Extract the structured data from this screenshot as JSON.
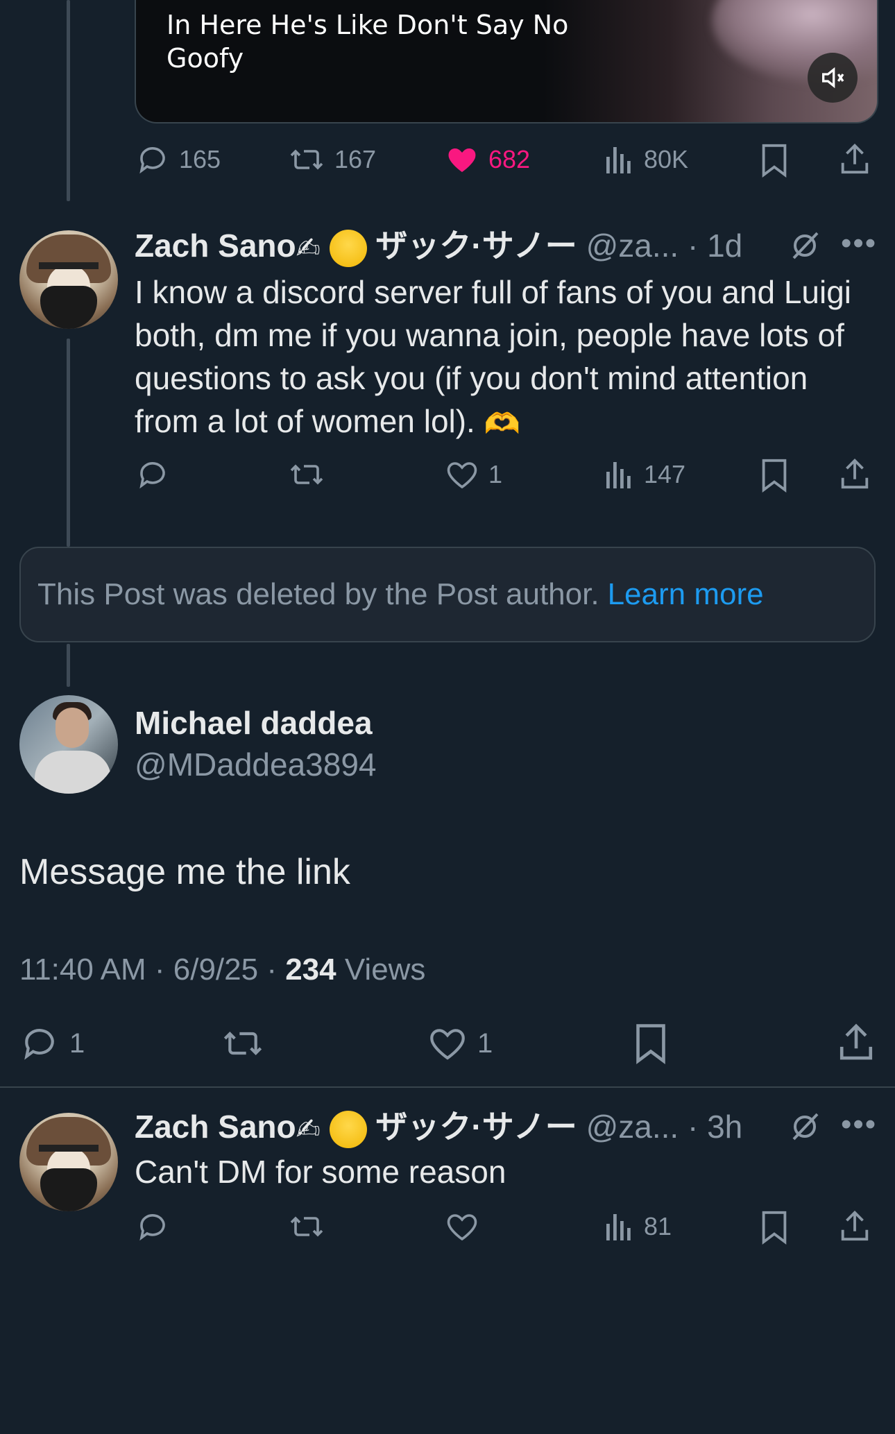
{
  "quoted_post": {
    "caption_line1": "In Here He's Like Don't Say No",
    "caption_line2": "Goofy",
    "replies": "165",
    "reposts": "167",
    "likes": "682",
    "views": "80K"
  },
  "reply1": {
    "name": "Zach Sano",
    "name_jp": "ザック·サノー",
    "handle": "@za...",
    "time": "1d",
    "text": "I know a discord server full of fans of you and Luigi both, dm me if you wanna join, people have lots of questions to ask you (if you don't mind attention from a lot of women lol).",
    "likes": "1",
    "views": "147"
  },
  "deleted": {
    "text": "This Post was deleted by the Post author.",
    "link": "Learn more"
  },
  "main_post": {
    "name": "Michael daddea",
    "handle": "@MDaddea3894",
    "text": "Message me the link",
    "time": "11:40 AM",
    "date": "6/9/25",
    "views_count": "234",
    "views_label": "Views",
    "replies": "1",
    "likes": "1"
  },
  "reply2": {
    "name": "Zach Sano",
    "name_jp": "ザック·サノー",
    "handle": "@za...",
    "time": "3h",
    "text": "Can't DM for some reason",
    "views": "81"
  },
  "colors": {
    "background": "#15202b",
    "text": "#e7e9ea",
    "muted": "#8b98a5",
    "like": "#f91880",
    "link": "#1d9bf0"
  }
}
